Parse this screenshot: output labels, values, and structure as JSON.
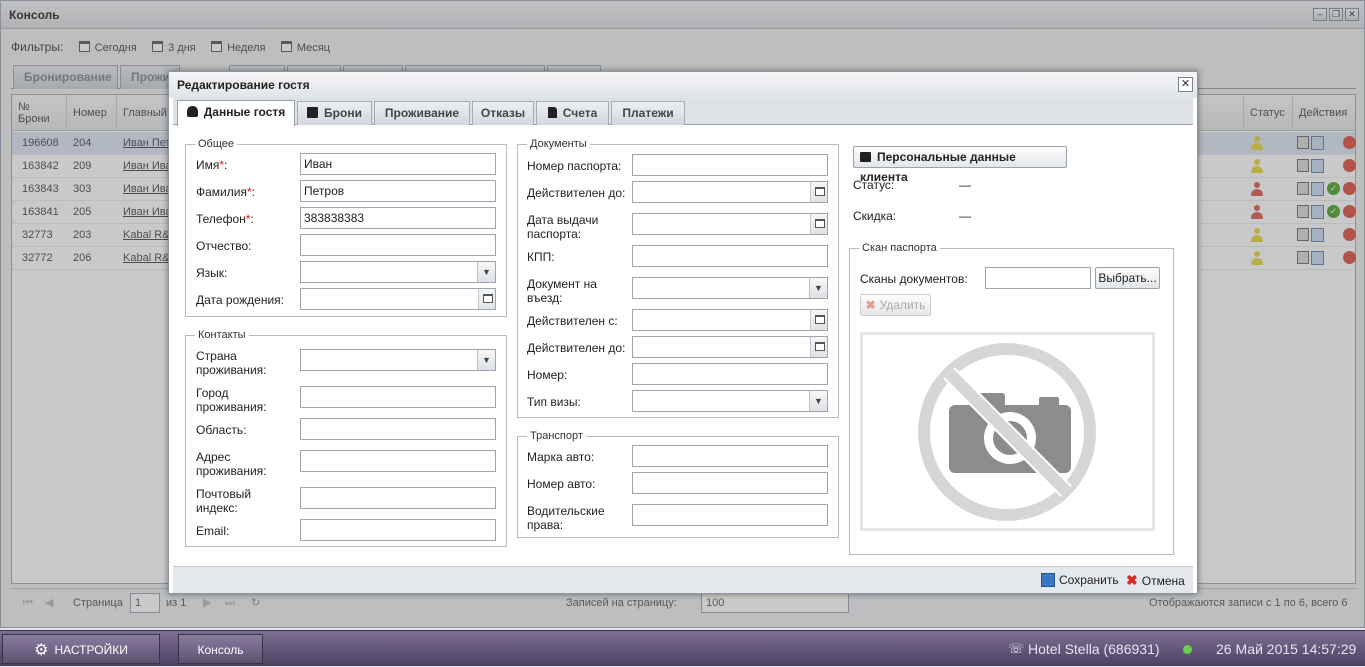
{
  "console": {
    "title": "Консоль",
    "window_buttons": [
      "‒",
      "❐",
      "✕"
    ],
    "filters": {
      "label": "Фильтры:",
      "items": [
        "Сегодня",
        "3 дня",
        "Неделя",
        "Месяц"
      ]
    },
    "tabs": [
      "Бронирование",
      "Прожи"
    ],
    "grid": {
      "headers": [
        "№ Брони",
        "Номер",
        "Главный",
        "Статус",
        "Действия"
      ],
      "rows": [
        {
          "id": "196608",
          "room": "204",
          "guest": "Иван Пет",
          "status": "yellow",
          "ok": false
        },
        {
          "id": "163842",
          "room": "209",
          "guest": "Иван Ива",
          "status": "yellow",
          "ok": false
        },
        {
          "id": "163843",
          "room": "303",
          "guest": "Иван Ива",
          "status": "red",
          "ok": true
        },
        {
          "id": "163841",
          "room": "205",
          "guest": "Иван Ива",
          "status": "red",
          "ok": true
        },
        {
          "id": "32773",
          "room": "203",
          "guest": "Kabal R&",
          "status": "yellow",
          "ok": false
        },
        {
          "id": "32772",
          "room": "206",
          "guest": "Kabal R&",
          "status": "yellow",
          "ok": false
        }
      ]
    },
    "pager": {
      "page_label": "Страница",
      "page": "1",
      "of": "из 1",
      "per_page_label": "Записей на страницу:",
      "per_page": "100",
      "summary": "Отображаются записи с 1 по 6, всего 6"
    }
  },
  "taskbar": {
    "settings": "НАСТРОЙКИ",
    "console": "Консоль",
    "hotel": "Hotel Stella (686931)",
    "datetime": "26 Май 2015 14:57:29"
  },
  "dialog": {
    "title": "Редактирование гостя",
    "close": "✕",
    "tabs": [
      "Данные гостя",
      "Брони",
      "Проживание",
      "Отказы",
      "Счета",
      "Платежи"
    ],
    "general": {
      "legend": "Общее",
      "name_label": "Имя",
      "name": "Иван",
      "surname_label": "Фамилия",
      "surname": "Петров",
      "phone_label": "Телефон",
      "phone": "383838383",
      "required_mark": "*",
      "colon": ":",
      "patronymic_label": "Отчество:",
      "language_label": "Язык:",
      "birthdate_label": "Дата рождения:"
    },
    "contacts": {
      "legend": "Контакты",
      "country_label": "Страна проживания:",
      "city_label": "Город проживания:",
      "region_label": "Область:",
      "address_label": "Адрес проживания:",
      "postal_label": "Почтовый индекс:",
      "email_label": "Email:"
    },
    "documents": {
      "legend": "Документы",
      "passport_label": "Номер паспорта:",
      "valid_until_label": "Действителен до:",
      "issue_date_label": "Дата выдачи паспорта:",
      "kpp_label": "КПП:",
      "entry_doc_label": "Документ на въезд:",
      "valid_from_label": "Действителен с:",
      "valid_to_label": "Действителен до:",
      "number_label": "Номер:",
      "visa_type_label": "Тип визы:"
    },
    "transport": {
      "legend": "Транспорт",
      "car_brand_label": "Марка авто:",
      "car_number_label": "Номер авто:",
      "license_label": "Водительские права:"
    },
    "personal_data_button": "Персональные данные клиента",
    "status_label": "Статус:",
    "status_value": "—",
    "discount_label": "Скидка:",
    "discount_value": "—",
    "scan": {
      "legend": "Скан паспорта",
      "docs_label": "Сканы документов:",
      "choose_button": "Выбрать...",
      "delete_button": "Удалить"
    },
    "footer": {
      "save": "Сохранить",
      "cancel": "Отмена"
    }
  }
}
